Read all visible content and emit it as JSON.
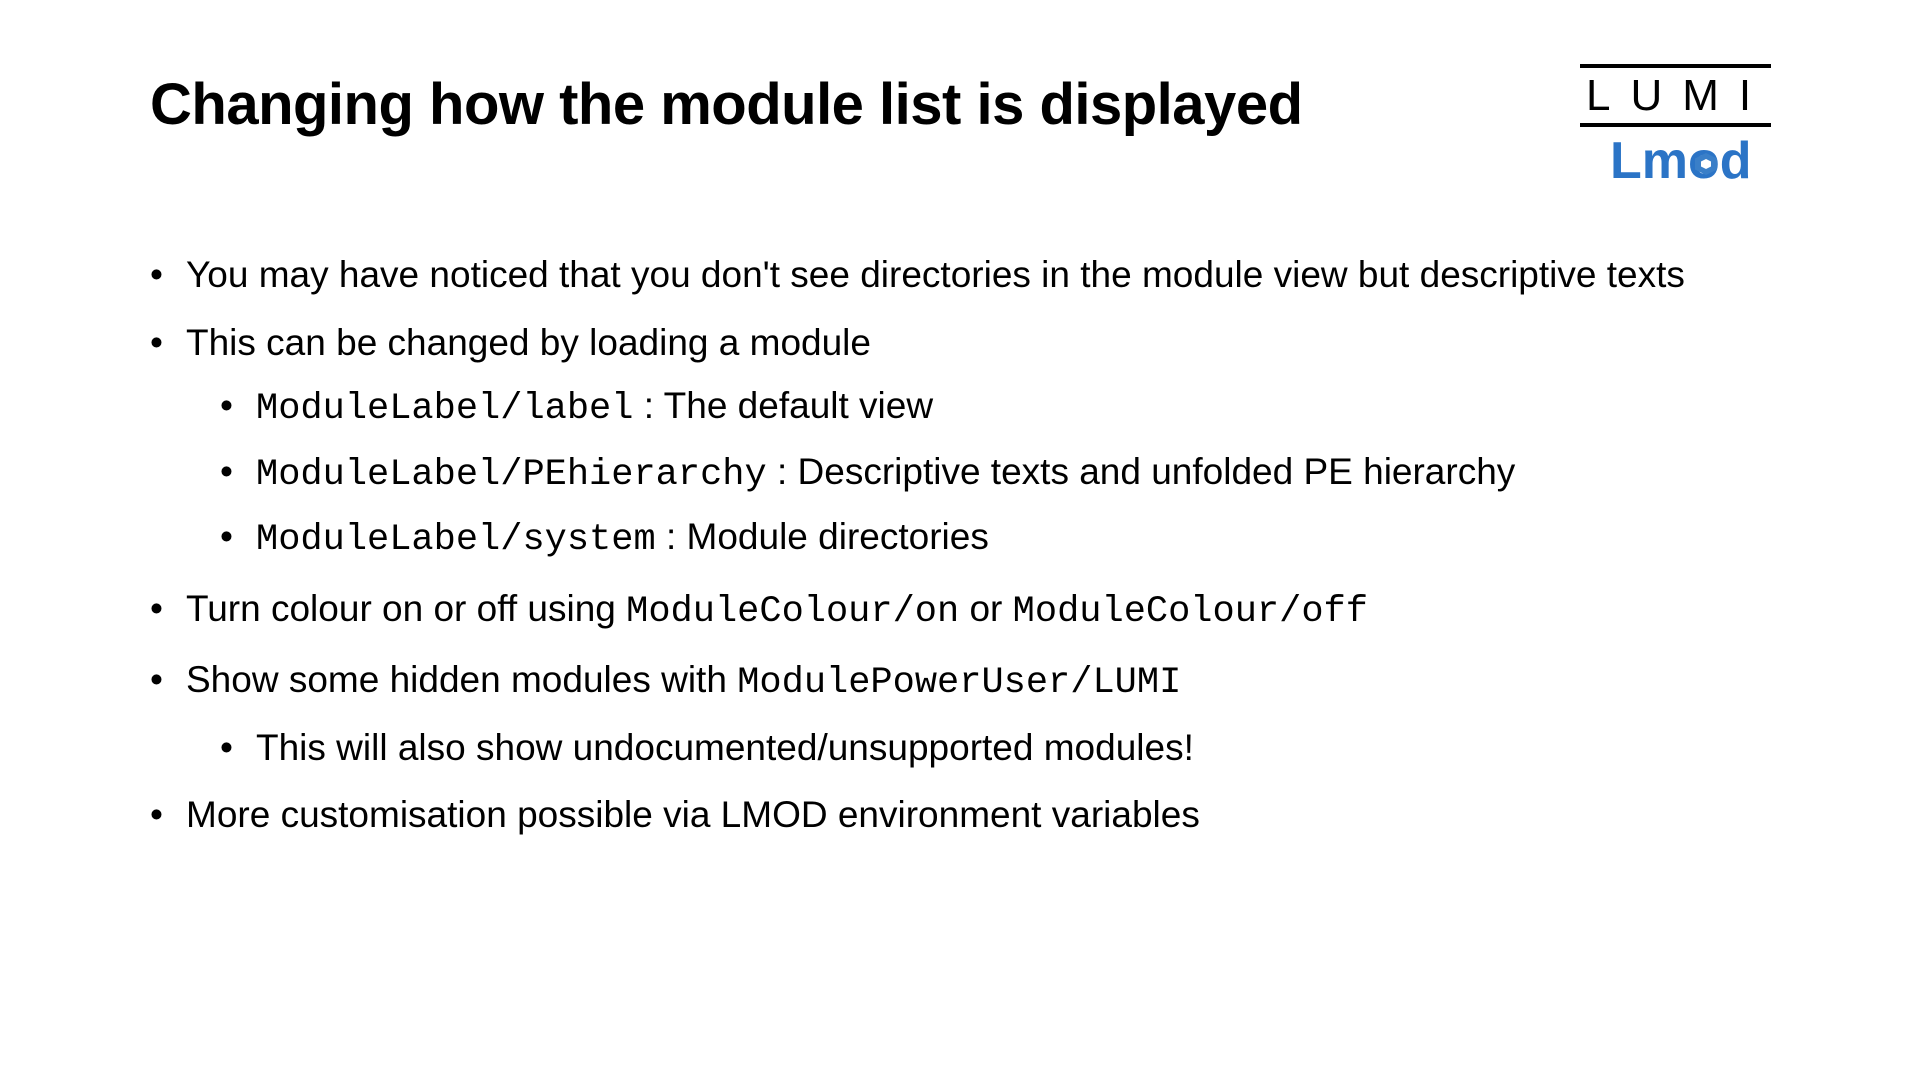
{
  "title": "Changing how the module list is displayed",
  "logo": {
    "lumi": "LUMI",
    "lmod_pre": "Lm",
    "lmod_post": "d"
  },
  "b1": "You may have noticed that you don't see directories in the module view but descriptive texts",
  "b2": "This can be changed by loading a module",
  "b2a_code": "ModuleLabel/label",
  "b2a_rest": " : The default view",
  "b2b_code": "ModuleLabel/PEhierarchy",
  "b2b_rest": " : Descriptive texts and unfolded PE hierarchy",
  "b2c_code": "ModuleLabel/system",
  "b2c_rest": " : Module directories",
  "b3_pre": "Turn colour on or off using ",
  "b3_code1": "ModuleColour/on",
  "b3_mid": " or ",
  "b3_code2": "ModuleColour/off",
  "b4_pre": "Show some hidden modules with ",
  "b4_code": "ModulePowerUser/LUMI",
  "b4a": "This will also show undocumented/unsupported modules!",
  "b5": "More customisation possible via LMOD environment variables"
}
